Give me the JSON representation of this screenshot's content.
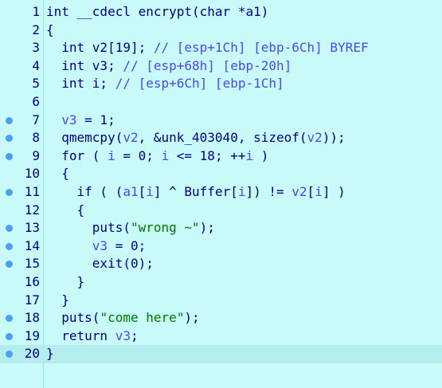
{
  "editor": {
    "lines": [
      {
        "num": "1",
        "bp": false,
        "segments": [
          {
            "t": "int __cdecl encrypt(char *a1)",
            "c": "k"
          }
        ]
      },
      {
        "num": "2",
        "bp": false,
        "segments": [
          {
            "t": "{",
            "c": "p"
          }
        ]
      },
      {
        "num": "3",
        "bp": false,
        "segments": [
          {
            "t": "  int v2[19]; ",
            "c": "k"
          },
          {
            "t": "// [esp+1Ch] [ebp-6Ch] BYREF",
            "c": "c"
          }
        ]
      },
      {
        "num": "4",
        "bp": false,
        "segments": [
          {
            "t": "  int v3; ",
            "c": "k"
          },
          {
            "t": "// [esp+68h] [ebp-20h]",
            "c": "c"
          }
        ]
      },
      {
        "num": "5",
        "bp": false,
        "segments": [
          {
            "t": "  int i; ",
            "c": "k"
          },
          {
            "t": "// [esp+6Ch] [ebp-1Ch]",
            "c": "c"
          }
        ]
      },
      {
        "num": "6",
        "bp": false,
        "segments": [
          {
            "t": "",
            "c": "p"
          }
        ]
      },
      {
        "num": "7",
        "bp": true,
        "segments": [
          {
            "t": "  ",
            "c": "p"
          },
          {
            "t": "v3",
            "c": "v"
          },
          {
            "t": " = 1;",
            "c": "p"
          }
        ]
      },
      {
        "num": "8",
        "bp": true,
        "segments": [
          {
            "t": "  qmemcpy(",
            "c": "p"
          },
          {
            "t": "v2",
            "c": "v"
          },
          {
            "t": ", &unk_403040, sizeof(",
            "c": "p"
          },
          {
            "t": "v2",
            "c": "v"
          },
          {
            "t": "));",
            "c": "p"
          }
        ]
      },
      {
        "num": "9",
        "bp": true,
        "segments": [
          {
            "t": "  for ( ",
            "c": "p"
          },
          {
            "t": "i",
            "c": "v"
          },
          {
            "t": " = 0; ",
            "c": "p"
          },
          {
            "t": "i",
            "c": "v"
          },
          {
            "t": " <= 18; ++",
            "c": "p"
          },
          {
            "t": "i",
            "c": "v"
          },
          {
            "t": " )",
            "c": "p"
          }
        ]
      },
      {
        "num": "10",
        "bp": false,
        "segments": [
          {
            "t": "  {",
            "c": "p"
          }
        ]
      },
      {
        "num": "11",
        "bp": true,
        "segments": [
          {
            "t": "    if ( (",
            "c": "p"
          },
          {
            "t": "a1",
            "c": "v"
          },
          {
            "t": "[",
            "c": "p"
          },
          {
            "t": "i",
            "c": "v"
          },
          {
            "t": "] ^ Buffer[",
            "c": "p"
          },
          {
            "t": "i",
            "c": "v"
          },
          {
            "t": "]) != ",
            "c": "p"
          },
          {
            "t": "v2",
            "c": "v"
          },
          {
            "t": "[",
            "c": "p"
          },
          {
            "t": "i",
            "c": "v"
          },
          {
            "t": "] )",
            "c": "p"
          }
        ]
      },
      {
        "num": "12",
        "bp": false,
        "segments": [
          {
            "t": "    {",
            "c": "p"
          }
        ]
      },
      {
        "num": "13",
        "bp": true,
        "segments": [
          {
            "t": "      puts(",
            "c": "p"
          },
          {
            "t": "\"wrong ~\"",
            "c": "s"
          },
          {
            "t": ");",
            "c": "p"
          }
        ]
      },
      {
        "num": "14",
        "bp": true,
        "segments": [
          {
            "t": "      ",
            "c": "p"
          },
          {
            "t": "v3",
            "c": "v"
          },
          {
            "t": " = 0;",
            "c": "p"
          }
        ]
      },
      {
        "num": "15",
        "bp": true,
        "segments": [
          {
            "t": "      exit(0);",
            "c": "p"
          }
        ]
      },
      {
        "num": "16",
        "bp": false,
        "segments": [
          {
            "t": "    }",
            "c": "p"
          }
        ]
      },
      {
        "num": "17",
        "bp": false,
        "segments": [
          {
            "t": "  }",
            "c": "p"
          }
        ]
      },
      {
        "num": "18",
        "bp": true,
        "segments": [
          {
            "t": "  puts(",
            "c": "p"
          },
          {
            "t": "\"come here\"",
            "c": "s"
          },
          {
            "t": ");",
            "c": "p"
          }
        ]
      },
      {
        "num": "19",
        "bp": true,
        "segments": [
          {
            "t": "  return ",
            "c": "p"
          },
          {
            "t": "v3",
            "c": "v"
          },
          {
            "t": ";",
            "c": "p"
          }
        ]
      },
      {
        "num": "20",
        "bp": true,
        "current": true,
        "segments": [
          {
            "t": "}",
            "c": "p"
          }
        ]
      }
    ]
  }
}
